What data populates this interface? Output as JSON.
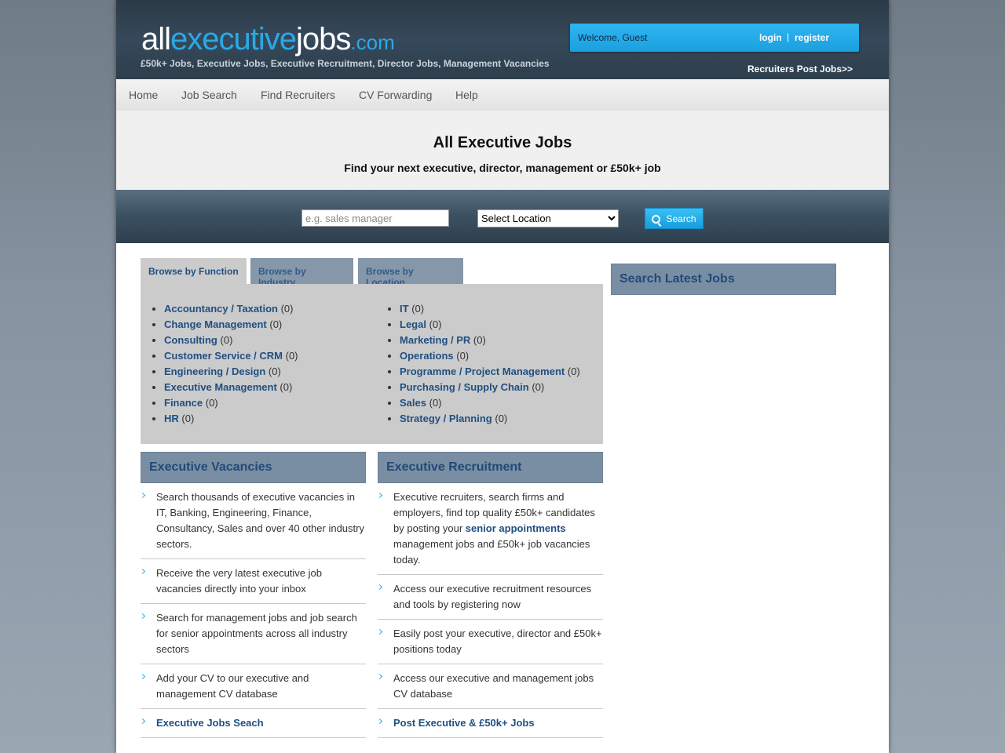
{
  "header": {
    "logo": {
      "part1": "all",
      "part2": "executive",
      "part3": "jobs",
      "part4": ".com"
    },
    "tagline": "£50k+ Jobs, Executive Jobs, Executive Recruitment, Director Jobs, Management Vacancies",
    "welcome": "Welcome, Guest",
    "login": "login",
    "separator": "|",
    "register": "register",
    "recruiters_link": "Recruiters Post Jobs>>"
  },
  "nav": {
    "items": [
      {
        "label": "Home"
      },
      {
        "label": "Job Search"
      },
      {
        "label": "Find Recruiters"
      },
      {
        "label": "CV Forwarding"
      },
      {
        "label": "Help"
      }
    ]
  },
  "hero": {
    "title": "All Executive Jobs",
    "subtitle": "Find your next executive, director, management or £50k+ job"
  },
  "search": {
    "keyword_placeholder": "e.g. sales manager",
    "location_selected": "Select Location",
    "button_label": "Search"
  },
  "browse": {
    "tabs": [
      {
        "label": "Browse by Function",
        "active": true
      },
      {
        "label": "Browse by Industry",
        "active": false
      },
      {
        "label": "Browse by Location",
        "active": false
      }
    ],
    "left_list": [
      {
        "label": "Accountancy / Taxation",
        "count": "(0)"
      },
      {
        "label": "Change Management",
        "count": "(0)"
      },
      {
        "label": "Consulting",
        "count": "(0)"
      },
      {
        "label": "Customer Service / CRM",
        "count": "(0)"
      },
      {
        "label": "Engineering / Design",
        "count": "(0)"
      },
      {
        "label": "Executive Management",
        "count": "(0)"
      },
      {
        "label": "Finance",
        "count": "(0)"
      },
      {
        "label": "HR",
        "count": "(0)"
      }
    ],
    "right_list": [
      {
        "label": "IT",
        "count": "(0)"
      },
      {
        "label": "Legal",
        "count": "(0)"
      },
      {
        "label": "Marketing / PR",
        "count": "(0)"
      },
      {
        "label": "Operations",
        "count": "(0)"
      },
      {
        "label": "Programme / Project Management",
        "count": "(0)"
      },
      {
        "label": "Purchasing / Supply Chain",
        "count": "(0)"
      },
      {
        "label": "Sales",
        "count": "(0)"
      },
      {
        "label": "Strategy / Planning",
        "count": "(0)"
      }
    ]
  },
  "sidebar": {
    "latest_title": "Search Latest Jobs"
  },
  "vacancies": {
    "title": "Executive Vacancies",
    "items": [
      "Search thousands of executive vacancies in IT, Banking, Engineering, Finance, Consultancy, Sales and over 40 other industry sectors.",
      "Receive the very latest executive job vacancies directly into your inbox",
      "Search for management jobs and job search for senior appointments across all industry sectors",
      "Add your CV to our executive and management CV database"
    ],
    "link": "Executive Jobs Seach"
  },
  "recruitment": {
    "title": "Executive Recruitment",
    "item1_pre": "Executive recruiters, search firms and employers, find top quality £50k+ candidates by posting your ",
    "item1_link": "senior appointments",
    "item1_post": " management jobs and £50k+ job vacancies today.",
    "items": [
      "Access our executive recruitment resources and tools by registering now",
      "Easily post your executive, director and £50k+ positions today",
      "Access our executive and management jobs CV database"
    ],
    "link": "Post Executive & £50k+ Jobs"
  },
  "colors": {
    "accent": "#29a9e8",
    "header_bg": "#2c3a47",
    "link": "#1f4f82",
    "panel_head": "#7a8ea3"
  }
}
